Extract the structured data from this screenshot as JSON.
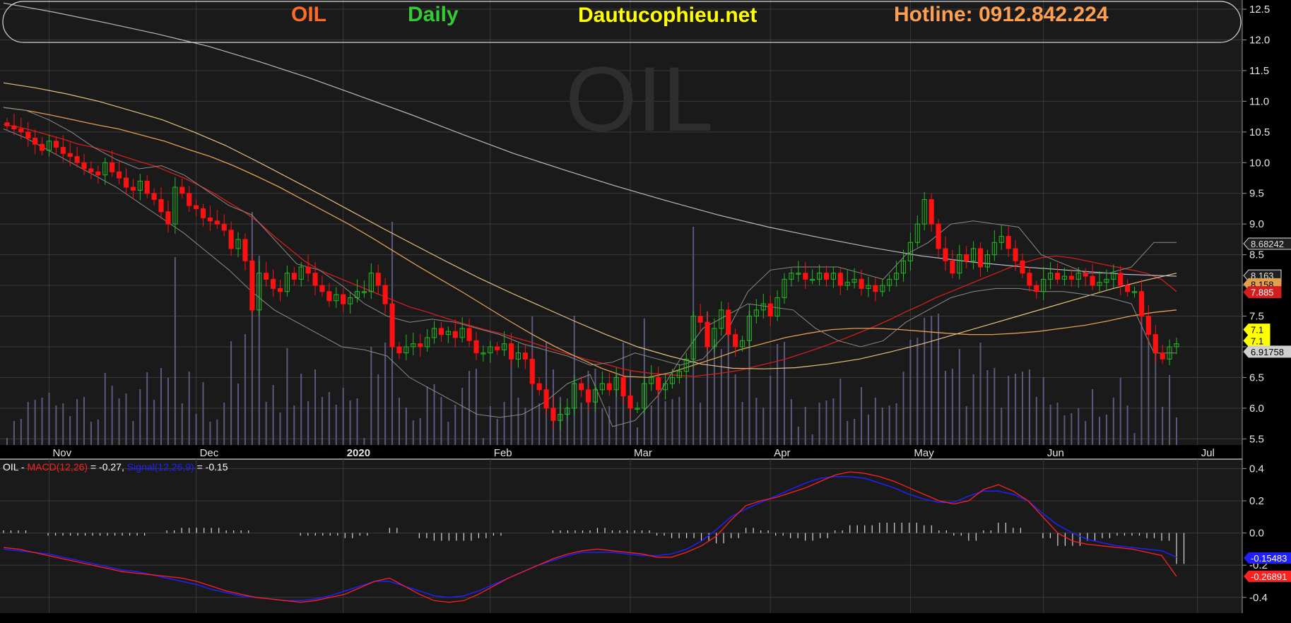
{
  "header": {
    "symbol": "OIL",
    "interval": "Daily",
    "site": "Dautucophieu.net",
    "hotline": "Hotline: 0912.842.224"
  },
  "watermark": "OIL",
  "colors": {
    "background": "#000000",
    "panel": "#1a1a1a",
    "grid": "#3a3a3a",
    "up": "#22bb22",
    "down": "#ff1111",
    "ma_red": "#d21e1e",
    "ma_orange": "#e0a050",
    "ma_lightorange": "#e8c080",
    "ma_gray": "#b8b8c8",
    "bollinger": "#8a8a8a",
    "volume": "#5a5a80",
    "macd_line": "#ff2020",
    "signal_line": "#2020ff",
    "symbol_color": "#ff6a2a",
    "interval_color": "#33cc33",
    "site_color": "#ffff00",
    "hotline_color": "#ff9f50"
  },
  "chart_data": [
    {
      "type": "candlestick",
      "symbol": "OIL",
      "interval": "Daily",
      "price_axis": {
        "ylim": [
          5.4,
          12.65
        ],
        "ticks": [
          "12.5",
          "12.0",
          "11.5",
          "11.0",
          "10.5",
          "10.0",
          "9.5",
          "9.0",
          "8.5",
          "8.0",
          "7.5",
          "7.0",
          "6.5",
          "6.0",
          "5.5"
        ]
      },
      "x_labels": [
        {
          "label": "Nov",
          "index": 6
        },
        {
          "label": "Dec",
          "index": 27
        },
        {
          "label": "2020",
          "index": 48
        },
        {
          "label": "Feb",
          "index": 69
        },
        {
          "label": "Mar",
          "index": 89
        },
        {
          "label": "Apr",
          "index": 109
        },
        {
          "label": "May",
          "index": 129
        },
        {
          "label": "Jun",
          "index": 148
        },
        {
          "label": "Jul",
          "index": 170
        }
      ],
      "series": [
        {
          "name": "close",
          "values": [
            10.6,
            10.55,
            10.5,
            10.4,
            10.3,
            10.2,
            10.35,
            10.25,
            10.15,
            10.1,
            10.0,
            9.9,
            9.85,
            9.8,
            10.0,
            9.85,
            9.75,
            9.6,
            9.55,
            9.7,
            9.5,
            9.4,
            9.2,
            9.0,
            9.6,
            9.5,
            9.3,
            9.25,
            9.1,
            9.05,
            9.0,
            8.9,
            8.6,
            8.75,
            8.4,
            7.6,
            8.2,
            8.1,
            7.95,
            7.9,
            8.2,
            8.1,
            8.3,
            8.2,
            8.0,
            7.9,
            7.75,
            7.85,
            7.7,
            7.8,
            7.9,
            7.9,
            8.2,
            8.0,
            7.7,
            7.0,
            6.9,
            7.0,
            7.05,
            7.0,
            7.15,
            7.3,
            7.2,
            7.25,
            7.15,
            7.3,
            7.1,
            6.9,
            6.9,
            7.0,
            6.95,
            7.05,
            6.8,
            6.9,
            6.8,
            6.4,
            6.3,
            6.0,
            5.8,
            5.9,
            6.0,
            6.4,
            6.3,
            6.1,
            6.3,
            6.4,
            6.3,
            6.5,
            6.2,
            6.0,
            6.0,
            6.4,
            6.5,
            6.3,
            6.4,
            6.5,
            6.6,
            6.8,
            7.5,
            7.4,
            7.0,
            7.3,
            7.6,
            7.2,
            7.0,
            7.1,
            7.5,
            7.6,
            7.7,
            7.5,
            7.8,
            8.1,
            8.2,
            8.2,
            8.1,
            8.1,
            8.2,
            8.1,
            8.2,
            8.0,
            8.05,
            8.1,
            7.95,
            8.0,
            7.9,
            8.0,
            8.1,
            8.2,
            8.4,
            8.7,
            9.0,
            9.4,
            9.0,
            8.6,
            8.4,
            8.2,
            8.5,
            8.4,
            8.6,
            8.3,
            8.5,
            8.7,
            8.8,
            8.6,
            8.4,
            8.2,
            8.0,
            7.9,
            8.1,
            8.2,
            8.1,
            8.15,
            8.1,
            8.2,
            8.15,
            8.0,
            8.05,
            8.1,
            8.2,
            8.0,
            7.9,
            7.9,
            7.5,
            7.2,
            6.9,
            6.8,
            7.0,
            7.05
          ]
        },
        {
          "name": "MA(20)",
          "values": [
            10.62,
            10.58,
            10.52,
            10.45,
            10.38,
            10.3,
            10.25,
            10.18,
            10.1,
            10.02,
            9.95,
            9.85,
            9.75,
            9.63,
            9.5,
            9.35,
            9.2,
            9.02,
            8.8,
            8.6,
            8.4,
            8.25,
            8.15,
            8.05,
            7.95,
            7.85,
            7.75,
            7.65,
            7.58,
            7.5,
            7.42,
            7.35,
            7.28,
            7.22,
            7.15,
            7.08,
            7.0,
            6.92,
            6.85,
            6.78,
            6.72,
            6.65,
            6.6,
            6.57,
            6.55,
            6.53,
            6.52,
            6.55,
            6.58,
            6.62,
            6.68,
            6.74,
            6.8,
            6.88,
            6.96,
            7.05,
            7.14,
            7.24,
            7.34,
            7.45,
            7.57,
            7.68,
            7.8,
            7.9,
            8.0,
            8.1,
            8.2,
            8.3,
            8.38,
            8.45,
            8.48,
            8.45,
            8.4,
            8.35,
            8.3,
            8.25,
            8.2,
            8.1,
            7.9
          ]
        },
        {
          "name": "MA(50)",
          "values": [
            10.9,
            10.85,
            10.78,
            10.7,
            10.62,
            10.55,
            10.45,
            10.35,
            10.22,
            10.1,
            9.95,
            9.78,
            9.6,
            9.4,
            9.2,
            9.0,
            8.78,
            8.55,
            8.32,
            8.1,
            7.88,
            7.65,
            7.42,
            7.2,
            7.0,
            6.82,
            6.65,
            6.52,
            6.5,
            6.58,
            6.7,
            6.82,
            6.95,
            7.05,
            7.15,
            7.22,
            7.28,
            7.3,
            7.3,
            7.28,
            7.25,
            7.22,
            7.2,
            7.2,
            7.22,
            7.25,
            7.3,
            7.35,
            7.42,
            7.5,
            7.56,
            7.6
          ]
        },
        {
          "name": "MA(100)",
          "values": [
            11.3,
            11.22,
            11.12,
            11.0,
            10.85,
            10.7,
            10.5,
            10.28,
            10.02,
            9.75,
            9.48,
            9.2,
            8.92,
            8.65,
            8.38,
            8.12,
            7.88,
            7.65,
            7.42,
            7.2,
            7.0,
            6.85,
            6.72,
            6.65,
            6.64,
            6.66,
            6.72,
            6.8,
            6.92,
            7.05,
            7.2,
            7.35,
            7.5,
            7.65,
            7.8,
            7.95,
            8.08,
            8.2
          ]
        },
        {
          "name": "MA(200)",
          "values": [
            12.6,
            12.45,
            12.28,
            12.1,
            11.9,
            11.65,
            11.38,
            11.08,
            10.78,
            10.46,
            10.15,
            9.88,
            9.62,
            9.38,
            9.15,
            8.95,
            8.78,
            8.62,
            8.48,
            8.38,
            8.3,
            8.24,
            8.18,
            8.15
          ]
        },
        {
          "name": "BB upper",
          "values": [
            10.9,
            10.85,
            10.7,
            10.5,
            10.25,
            10.05,
            9.9,
            9.95,
            9.8,
            9.55,
            9.3,
            9.15,
            8.75,
            8.35,
            8.25,
            8.0,
            7.7,
            7.5,
            7.4,
            7.45,
            7.4,
            7.3,
            7.2,
            7.05,
            6.95,
            6.85,
            6.7,
            6.75,
            6.9,
            6.8,
            6.7,
            6.8,
            7.2,
            7.9,
            8.25,
            8.3,
            8.3,
            8.3,
            8.2,
            8.1,
            8.5,
            8.7,
            9.0,
            9.05,
            9.0,
            8.95,
            8.5,
            8.35,
            8.2,
            8.2,
            8.3,
            8.7,
            8.7
          ]
        },
        {
          "name": "BB lower",
          "values": [
            10.55,
            10.4,
            10.2,
            10.0,
            9.8,
            9.6,
            9.35,
            9.1,
            8.85,
            8.55,
            8.25,
            7.9,
            7.6,
            7.4,
            7.2,
            7.0,
            6.95,
            6.85,
            6.5,
            6.3,
            6.1,
            5.9,
            5.85,
            5.9,
            6.1,
            6.4,
            6.55,
            5.7,
            5.8,
            6.2,
            6.8,
            7.3,
            7.5,
            7.7,
            7.65,
            7.6,
            7.3,
            7.1,
            7.0,
            7.1,
            7.4,
            7.6,
            7.8,
            7.9,
            7.95,
            7.95,
            7.9,
            7.9,
            7.85,
            7.8,
            7.7,
            6.9,
            6.9
          ]
        }
      ],
      "last_values": [
        {
          "label": "8.68242",
          "value": 8.68
        },
        {
          "label": "8.163",
          "value": 8.16
        },
        {
          "label": "8.158",
          "value": 8.02
        },
        {
          "label": "7.885",
          "value": 7.89
        },
        {
          "label": "7.1",
          "value": 7.28
        },
        {
          "label": "7.1",
          "value": 7.1
        },
        {
          "label": "6.91758",
          "value": 6.92
        }
      ]
    },
    {
      "type": "macd",
      "legend": {
        "prefix": "OIL - ",
        "macd_name": "MACD(12,26)",
        "macd_value": " = -0.27, ",
        "signal_name": "Signal(12,26,9)",
        "signal_value": " = -0.15"
      },
      "ylim": [
        -0.48,
        0.45
      ],
      "ticks": [
        "0.4",
        "0.2",
        "0.0",
        "-0.2",
        "-0.4"
      ],
      "series": [
        {
          "name": "MACD",
          "values": [
            -0.09,
            -0.1,
            -0.12,
            -0.14,
            -0.16,
            -0.18,
            -0.2,
            -0.22,
            -0.24,
            -0.25,
            -0.26,
            -0.27,
            -0.28,
            -0.3,
            -0.33,
            -0.36,
            -0.38,
            -0.4,
            -0.41,
            -0.42,
            -0.43,
            -0.42,
            -0.4,
            -0.38,
            -0.34,
            -0.3,
            -0.28,
            -0.33,
            -0.38,
            -0.42,
            -0.43,
            -0.42,
            -0.38,
            -0.33,
            -0.28,
            -0.24,
            -0.2,
            -0.16,
            -0.13,
            -0.11,
            -0.1,
            -0.11,
            -0.12,
            -0.13,
            -0.15,
            -0.15,
            -0.12,
            -0.08,
            -0.02,
            0.08,
            0.17,
            0.2,
            0.22,
            0.25,
            0.28,
            0.32,
            0.36,
            0.38,
            0.37,
            0.35,
            0.32,
            0.28,
            0.24,
            0.2,
            0.18,
            0.2,
            0.27,
            0.3,
            0.26,
            0.2,
            0.1,
            0.0,
            -0.05,
            -0.07,
            -0.08,
            -0.09,
            -0.1,
            -0.12,
            -0.14,
            -0.27
          ]
        },
        {
          "name": "Signal",
          "values": [
            -0.1,
            -0.11,
            -0.12,
            -0.13,
            -0.15,
            -0.17,
            -0.19,
            -0.21,
            -0.23,
            -0.24,
            -0.26,
            -0.28,
            -0.3,
            -0.32,
            -0.35,
            -0.37,
            -0.39,
            -0.4,
            -0.41,
            -0.42,
            -0.42,
            -0.41,
            -0.39,
            -0.36,
            -0.33,
            -0.3,
            -0.3,
            -0.33,
            -0.36,
            -0.39,
            -0.4,
            -0.39,
            -0.36,
            -0.32,
            -0.28,
            -0.24,
            -0.2,
            -0.17,
            -0.14,
            -0.12,
            -0.12,
            -0.12,
            -0.13,
            -0.14,
            -0.14,
            -0.13,
            -0.1,
            -0.05,
            0.02,
            0.1,
            0.15,
            0.19,
            0.23,
            0.27,
            0.31,
            0.34,
            0.35,
            0.35,
            0.34,
            0.31,
            0.28,
            0.24,
            0.21,
            0.19,
            0.19,
            0.23,
            0.26,
            0.26,
            0.24,
            0.2,
            0.12,
            0.05,
            0.0,
            -0.04,
            -0.06,
            -0.08,
            -0.09,
            -0.1,
            -0.11,
            -0.15
          ]
        }
      ],
      "last_values": [
        {
          "label": "-0.15483",
          "value": -0.155
        },
        {
          "label": "-0.26891",
          "value": -0.269
        }
      ]
    }
  ]
}
